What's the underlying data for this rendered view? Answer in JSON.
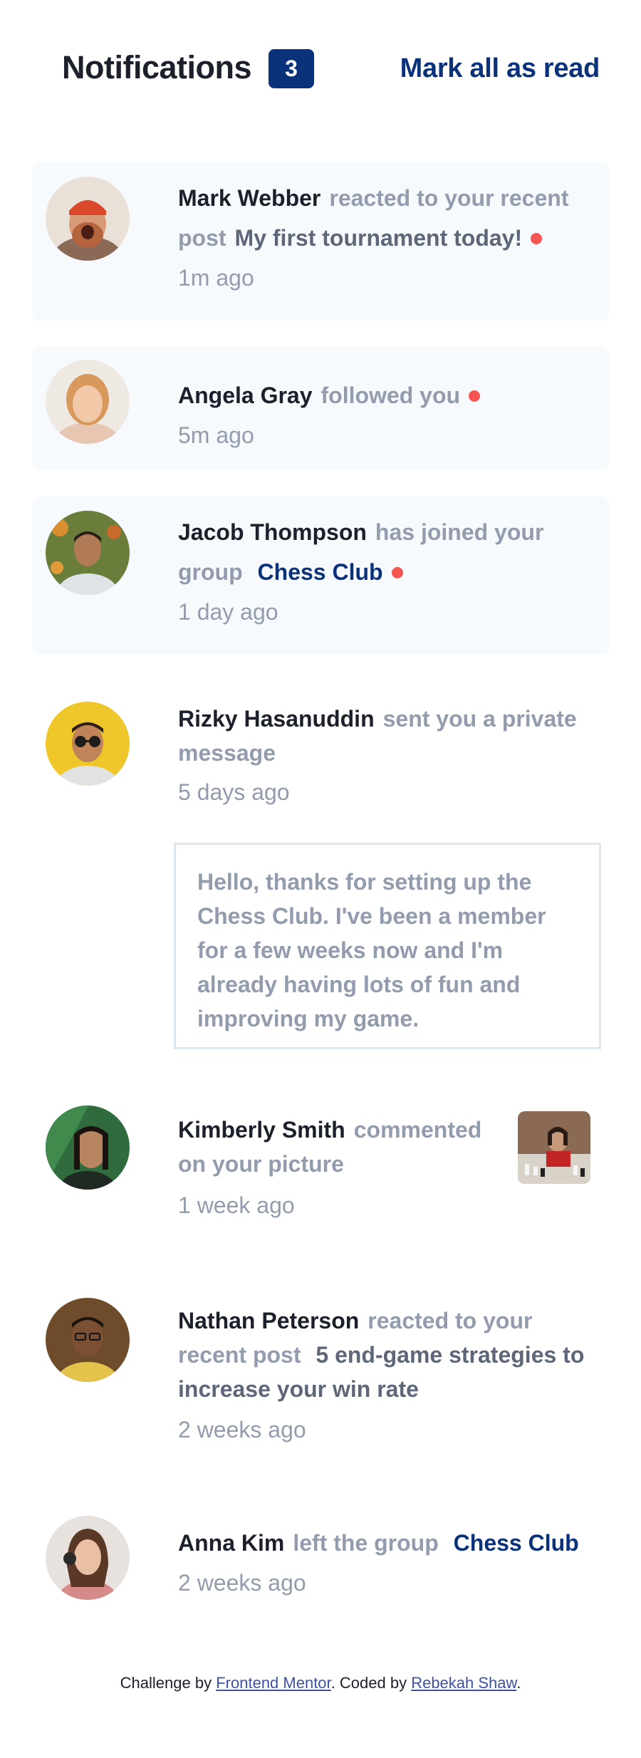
{
  "header": {
    "title": "Notifications",
    "count": "3",
    "mark_all": "Mark all as read"
  },
  "notifications": [
    {
      "name": "Mark Webber",
      "action": "reacted to your recent post",
      "target": "My first tournament today!",
      "time": "1m ago",
      "unread": true
    },
    {
      "name": "Angela Gray",
      "action": "followed you",
      "time": "5m ago",
      "unread": true
    },
    {
      "name": "Jacob Thompson",
      "action": "has joined your group",
      "target": "Chess Club",
      "time": "1 day ago",
      "unread": true
    },
    {
      "name": "Rizky Hasanuddin",
      "action": "sent you a private message",
      "time": "5 days ago",
      "unread": false,
      "message": "Hello, thanks for setting up the Chess Club. I've been a member for a few weeks now and I'm already having lots of fun and improving my game."
    },
    {
      "name": "Kimberly Smith",
      "action": "commented on your picture",
      "time": "1 week ago",
      "unread": false
    },
    {
      "name": "Nathan Peterson",
      "action": "reacted to your recent post",
      "target": "5 end-game strategies to increase your win rate",
      "time": "2 weeks ago",
      "unread": false
    },
    {
      "name": "Anna Kim",
      "action": "left the group",
      "target": "Chess Club",
      "time": "2 weeks ago",
      "unread": false
    }
  ],
  "footer": {
    "prefix": "Challenge by",
    "link1": "Frontend Mentor",
    "middle": ". Coded by",
    "link2": "Rebekah Shaw",
    "suffix": "."
  },
  "colors": {
    "accent": "#0a327b",
    "unread_bg": "#f7fafd",
    "dot": "#f65552",
    "muted": "#939cad"
  }
}
